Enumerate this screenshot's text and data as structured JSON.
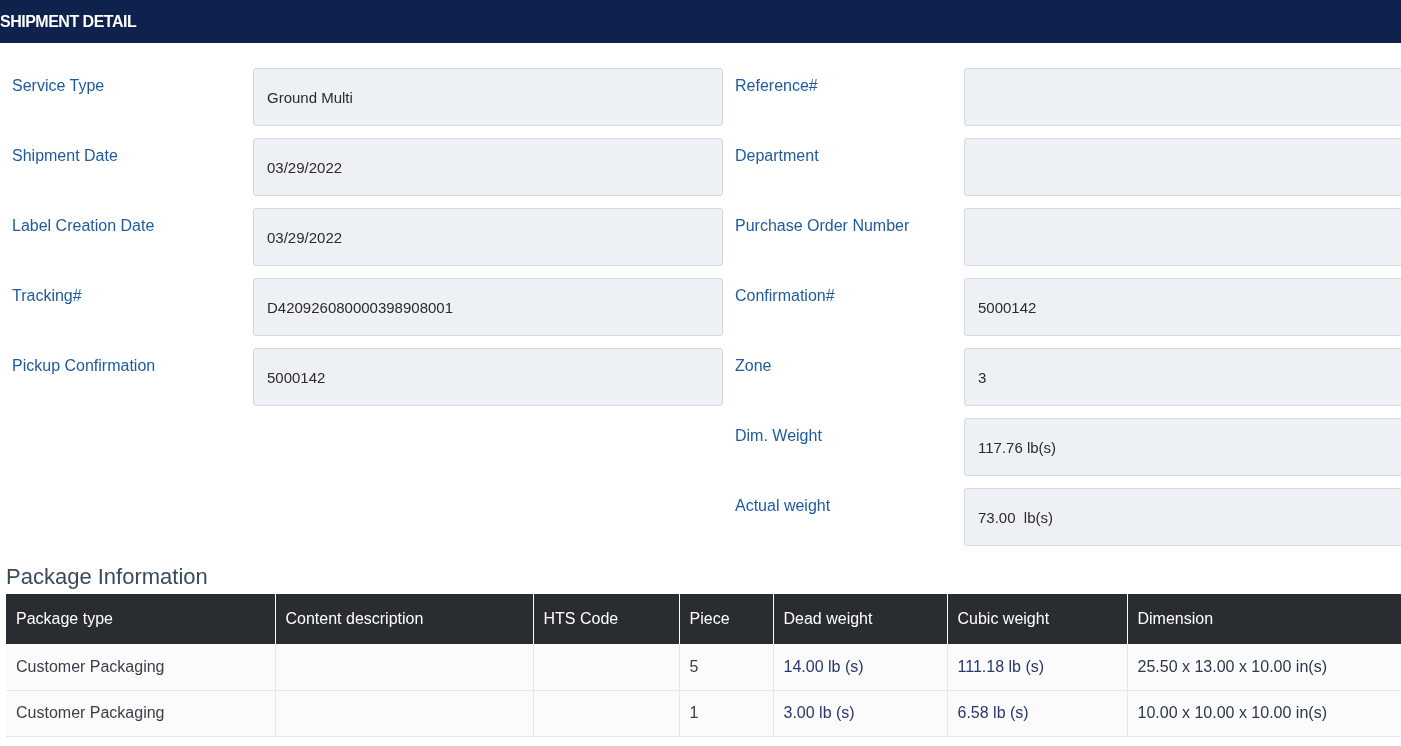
{
  "header": {
    "title": "SHIPMENT DETAIL"
  },
  "left_fields": [
    {
      "label": "Service Type",
      "value": "Ground Multi"
    },
    {
      "label": "Shipment Date",
      "value": "03/29/2022"
    },
    {
      "label": "Label Creation Date",
      "value": "03/29/2022"
    },
    {
      "label": "Tracking#",
      "value": "D420926080000398908001"
    },
    {
      "label": "Pickup Confirmation",
      "value": "5000142"
    }
  ],
  "right_fields": [
    {
      "label": "Reference#"
    },
    {
      "label": "Department"
    },
    {
      "label": "Purchase Order Number"
    },
    {
      "label": "Confirmation#",
      "value": "5000142"
    },
    {
      "label": "Zone",
      "value": "3"
    },
    {
      "label": "Dim. Weight",
      "value": "117.76 lb(s)"
    },
    {
      "label": "Actual weight",
      "value": "73.00  lb(s)"
    }
  ],
  "package_information": {
    "title": "Package Information",
    "columns": [
      "Package type",
      "Content description",
      "HTS Code",
      "Piece",
      "Dead weight",
      "Cubic weight",
      "Dimension"
    ],
    "rows": [
      [
        "Customer Packaging",
        "",
        "",
        "5",
        "14.00 lb (s)",
        "111.18 lb (s)",
        "25.50 x 13.00 x 10.00 in(s)"
      ],
      [
        "Customer Packaging",
        "",
        "",
        "1",
        "3.00 lb (s)",
        "6.58 lb (s)",
        "10.00 x 10.00 x 10.00 in(s)"
      ]
    ]
  }
}
